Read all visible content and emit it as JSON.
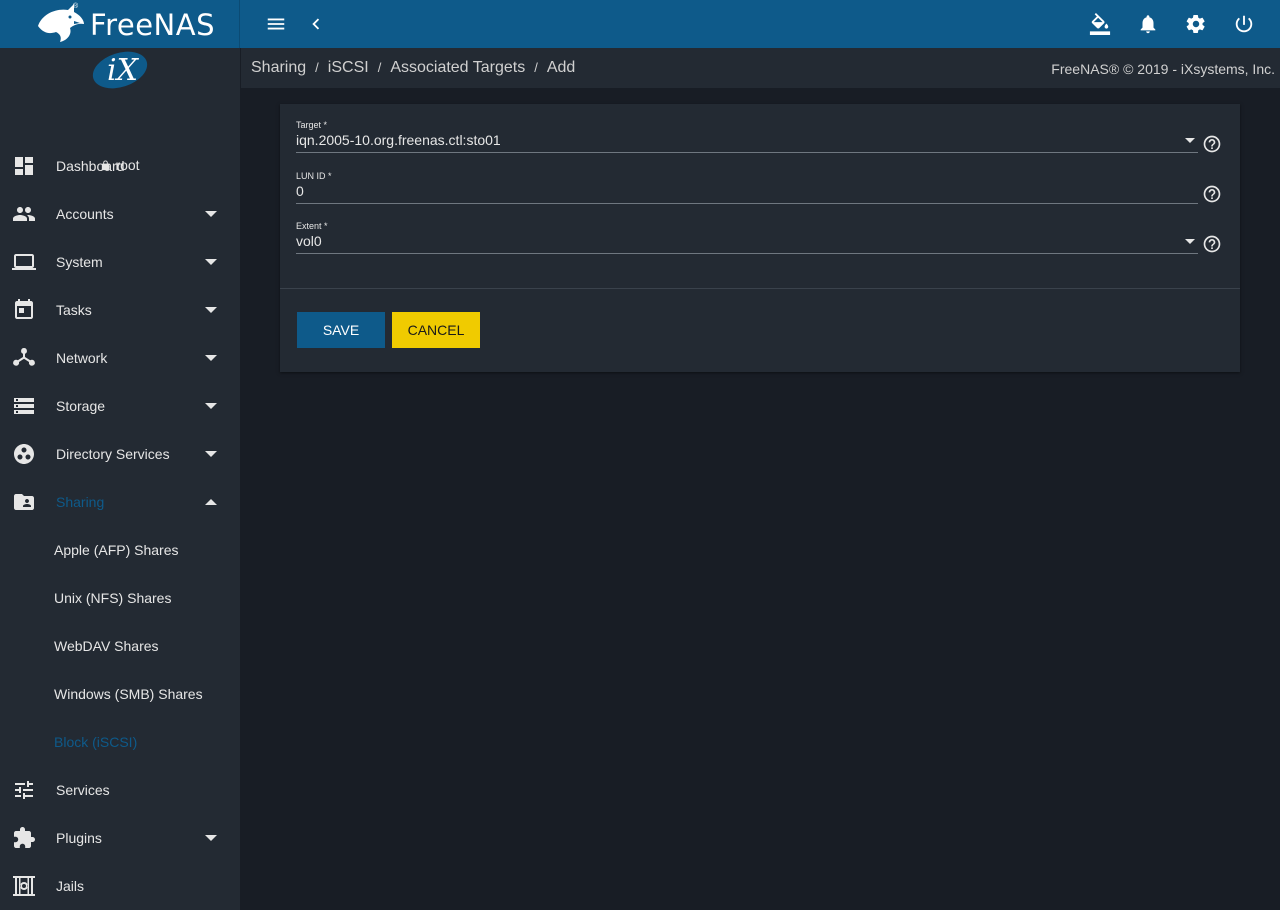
{
  "brand": {
    "name": "FreeNAS",
    "reg": "®"
  },
  "user": {
    "name": "root"
  },
  "sidebar": {
    "items": [
      {
        "label": "Dashboard",
        "icon": "dashboard-icon"
      },
      {
        "label": "Accounts",
        "icon": "accounts-icon"
      },
      {
        "label": "System",
        "icon": "laptop-icon"
      },
      {
        "label": "Tasks",
        "icon": "calendar-icon"
      },
      {
        "label": "Network",
        "icon": "network-icon"
      },
      {
        "label": "Storage",
        "icon": "storage-icon"
      },
      {
        "label": "Directory Services",
        "icon": "directory-icon"
      },
      {
        "label": "Sharing",
        "icon": "folder-shared-icon"
      },
      {
        "label": "Services",
        "icon": "tune-icon"
      },
      {
        "label": "Plugins",
        "icon": "puzzle-icon"
      },
      {
        "label": "Jails",
        "icon": "jail-icon"
      }
    ],
    "sharing_sub": [
      {
        "label": "Apple (AFP) Shares"
      },
      {
        "label": "Unix (NFS) Shares"
      },
      {
        "label": "WebDAV Shares"
      },
      {
        "label": "Windows (SMB) Shares"
      },
      {
        "label": "Block (iSCSI)"
      }
    ]
  },
  "breadcrumb": [
    "Sharing",
    "iSCSI",
    "Associated Targets",
    "Add"
  ],
  "copyright": "FreeNAS® © 2019 - iXsystems, Inc.",
  "form": {
    "target": {
      "label": "Target *",
      "value": "iqn.2005-10.org.freenas.ctl:sto01"
    },
    "lun_id": {
      "label": "LUN ID *",
      "value": "0"
    },
    "extent": {
      "label": "Extent *",
      "value": "vol0"
    },
    "save_label": "SAVE",
    "cancel_label": "CANCEL"
  },
  "colors": {
    "primary": "#0e5a8a",
    "accent": "#f0cb00",
    "sidebar": "#232a33",
    "background": "#181d25"
  }
}
